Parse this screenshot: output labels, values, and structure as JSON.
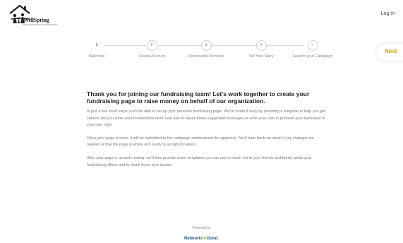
{
  "header": {
    "brand": "WellSpring",
    "tagline": "NOT FOR PROFIT CORPORATION",
    "login": "Log In"
  },
  "steps": [
    {
      "number": "1",
      "label": "Welcome",
      "icon": ""
    },
    {
      "number": "2",
      "label": "Create Account",
      "icon": ""
    },
    {
      "number": "3",
      "label": "Personalize Account",
      "icon": ""
    },
    {
      "number": "4",
      "label": "Tell Your Story",
      "icon": ""
    },
    {
      "number": "✓",
      "label": "Launch your Campaign",
      "icon": "check-icon"
    }
  ],
  "next_label": "Next",
  "main": {
    "title": "Thank you for joining our fundraising team! Let's work together to create your fundraising page to raise money on behalf of our organization.",
    "paragraphs": [
      "In just a few short steps you'll be able to set up your personal fundraising page. We've made it easy by providing a template to help you get started, but you know your connections best! Feel free to tweak these suggested messages or write your own to promote your fundraiser in your own style.",
      "Once your page is done, it will be submitted to the campaign administrator for approval. You'll hear back via email if any changes are needed or that the page is active and ready to accept donations.",
      "After your page is up and running, we'll also provide some templates you can use to reach out to your friends and family about your fundraising efforts and to thank those who donate"
    ]
  },
  "footer": {
    "powered_by": "Powered by",
    "network_label": "Network",
    "for_label": "for",
    "good_label": "Good."
  },
  "colors": {
    "next_text": "#c9a600",
    "nfg_blue": "#1a4f8a",
    "nfg_green": "#8aa64a"
  }
}
